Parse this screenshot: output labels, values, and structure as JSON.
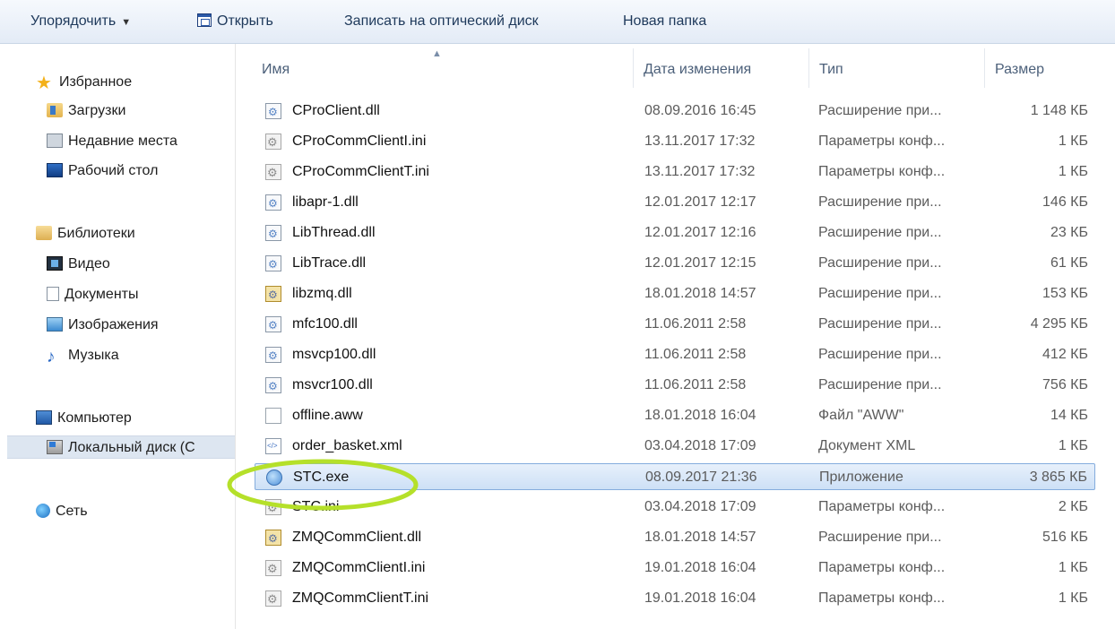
{
  "toolbar": {
    "organize": "Упорядочить",
    "open": "Открыть",
    "burn": "Записать на оптический диск",
    "new_folder": "Новая папка"
  },
  "nav": {
    "favorites": "Избранное",
    "downloads": "Загрузки",
    "recent": "Недавние места",
    "desktop": "Рабочий стол",
    "libraries": "Библиотеки",
    "video": "Видео",
    "documents": "Документы",
    "images": "Изображения",
    "music": "Музыка",
    "computer": "Компьютер",
    "local_disk": "Локальный диск (С",
    "network": "Сеть"
  },
  "columns": {
    "name": "Имя",
    "date": "Дата изменения",
    "type": "Тип",
    "size": "Размер"
  },
  "highlight_color": "#b5e02a",
  "files": [
    {
      "name": "CProClient.dll",
      "date": "08.09.2016 16:45",
      "type": "Расширение при...",
      "size": "1 148 КБ",
      "icon": "dll-icon"
    },
    {
      "name": "CProCommClientI.ini",
      "date": "13.11.2017 17:32",
      "type": "Параметры конф...",
      "size": "1 КБ",
      "icon": "ini-icon"
    },
    {
      "name": "CProCommClientT.ini",
      "date": "13.11.2017 17:32",
      "type": "Параметры конф...",
      "size": "1 КБ",
      "icon": "ini-icon"
    },
    {
      "name": "libapr-1.dll",
      "date": "12.01.2017 12:17",
      "type": "Расширение при...",
      "size": "146 КБ",
      "icon": "dll-icon"
    },
    {
      "name": "LibThread.dll",
      "date": "12.01.2017 12:16",
      "type": "Расширение при...",
      "size": "23 КБ",
      "icon": "dll-icon"
    },
    {
      "name": "LibTrace.dll",
      "date": "12.01.2017 12:15",
      "type": "Расширение при...",
      "size": "61 КБ",
      "icon": "dll-icon"
    },
    {
      "name": "libzmq.dll",
      "date": "18.01.2018 14:57",
      "type": "Расширение при...",
      "size": "153 КБ",
      "icon": "dll-signed-icon"
    },
    {
      "name": "mfc100.dll",
      "date": "11.06.2011 2:58",
      "type": "Расширение при...",
      "size": "4 295 КБ",
      "icon": "dll-icon"
    },
    {
      "name": "msvcp100.dll",
      "date": "11.06.2011 2:58",
      "type": "Расширение при...",
      "size": "412 КБ",
      "icon": "dll-icon"
    },
    {
      "name": "msvcr100.dll",
      "date": "11.06.2011 2:58",
      "type": "Расширение при...",
      "size": "756 КБ",
      "icon": "dll-icon"
    },
    {
      "name": "offline.aww",
      "date": "18.01.2018 16:04",
      "type": "Файл \"AWW\"",
      "size": "14 КБ",
      "icon": "blank-file-icon"
    },
    {
      "name": "order_basket.xml",
      "date": "03.04.2018 17:09",
      "type": "Документ XML",
      "size": "1 КБ",
      "icon": "xml-icon"
    },
    {
      "name": "STC.exe",
      "date": "08.09.2017 21:36",
      "type": "Приложение",
      "size": "3 865 КБ",
      "icon": "exe-icon",
      "selected": true
    },
    {
      "name": "STC.ini",
      "date": "03.04.2018 17:09",
      "type": "Параметры конф...",
      "size": "2 КБ",
      "icon": "ini-icon"
    },
    {
      "name": "ZMQCommClient.dll",
      "date": "18.01.2018 14:57",
      "type": "Расширение при...",
      "size": "516 КБ",
      "icon": "dll-signed-icon"
    },
    {
      "name": "ZMQCommClientI.ini",
      "date": "19.01.2018 16:04",
      "type": "Параметры конф...",
      "size": "1 КБ",
      "icon": "ini-icon"
    },
    {
      "name": "ZMQCommClientT.ini",
      "date": "19.01.2018 16:04",
      "type": "Параметры конф...",
      "size": "1 КБ",
      "icon": "ini-icon"
    }
  ]
}
